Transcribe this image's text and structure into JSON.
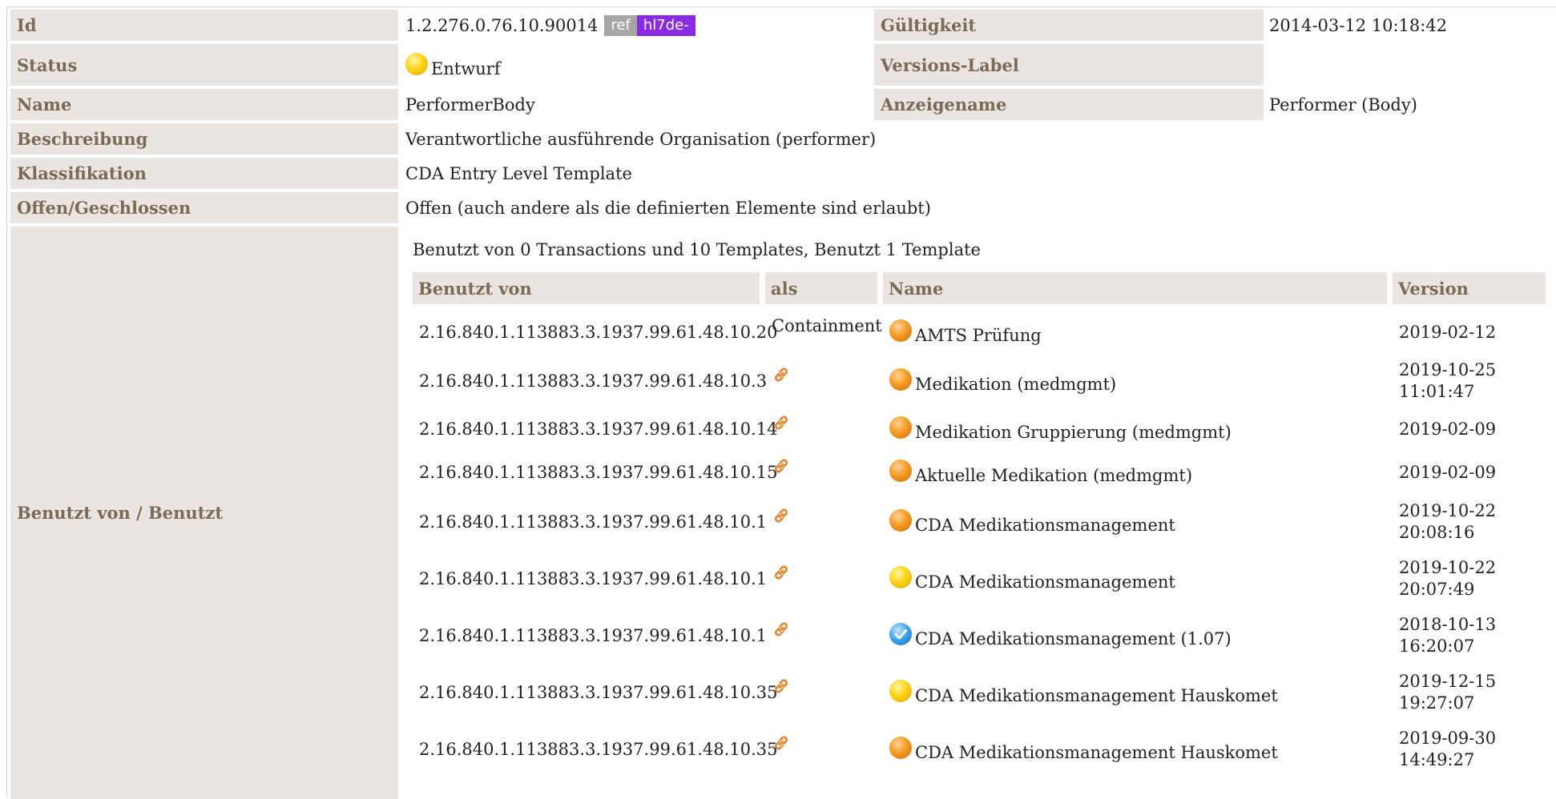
{
  "fields": {
    "id_label": "Id",
    "id_value": "1.2.276.0.76.10.90014",
    "ref_badge": "ref",
    "prefix_badge": "hl7de-",
    "gueltigkeit_label": "Gültigkeit",
    "gueltigkeit_value": "2014-03-12 10:18:42",
    "status_label": "Status",
    "status_value": "Entwurf",
    "status_color": "#ffd21a",
    "versions_label_label": "Versions-Label",
    "versions_label_value": "",
    "name_label": "Name",
    "name_value": "PerformerBody",
    "anzeigename_label": "Anzeigename",
    "anzeigename_value": "Performer (Body)",
    "beschreibung_label": "Beschreibung",
    "beschreibung_value": "Verantwortliche ausführende Organisation (performer)",
    "klassifikation_label": "Klassifikation",
    "klassifikation_value": "CDA Entry Level Template",
    "offen_label": "Offen/Geschlossen",
    "offen_value": "Offen (auch andere als die definierten Elemente sind erlaubt)",
    "benutzt_label": "Benutzt von / Benutzt"
  },
  "usage": {
    "summary": "Benutzt von 0 Transactions und 10 Templates, Benutzt 1 Template",
    "headers": {
      "used_by": "Benutzt von",
      "as": "als",
      "name": "Name",
      "version": "Version"
    },
    "rows": [
      {
        "id": "2.16.840.1.113883.3.1937.99.61.48.10.20",
        "as": "Containment",
        "status": "orange",
        "name": "AMTS Prüfung",
        "version": "2019-02-12"
      },
      {
        "id": "2.16.840.1.113883.3.1937.99.61.48.10.3",
        "as": "",
        "as_icon": "link-icon",
        "status": "orange",
        "name": "Medikation (medmgmt)",
        "version": "2019-10-25 11:01:47"
      },
      {
        "id": "2.16.840.1.113883.3.1937.99.61.48.10.14",
        "as": "",
        "as_icon": "link-icon",
        "status": "orange",
        "name": "Medikation Gruppierung (medmgmt)",
        "version": "2019-02-09"
      },
      {
        "id": "2.16.840.1.113883.3.1937.99.61.48.10.15",
        "as": "",
        "as_icon": "link-icon",
        "status": "orange",
        "name": "Aktuelle Medikation (medmgmt)",
        "version": "2019-02-09"
      },
      {
        "id": "2.16.840.1.113883.3.1937.99.61.48.10.1",
        "as": "",
        "as_icon": "link-icon",
        "status": "orange",
        "name": "CDA Medikationsmanagement",
        "version": "2019-10-22 20:08:16"
      },
      {
        "id": "2.16.840.1.113883.3.1937.99.61.48.10.1",
        "as": "",
        "as_icon": "link-icon",
        "status": "yellow",
        "name": "CDA Medikationsmanagement",
        "version": "2019-10-22 20:07:49"
      },
      {
        "id": "2.16.840.1.113883.3.1937.99.61.48.10.1",
        "as": "",
        "as_icon": "link-icon",
        "status": "blue-check",
        "name": "CDA Medikationsmanagement (1.07)",
        "version": "2018-10-13 16:20:07"
      },
      {
        "id": "2.16.840.1.113883.3.1937.99.61.48.10.35",
        "as": "",
        "as_icon": "link-icon",
        "status": "yellow",
        "name": "CDA Medikationsmanagement Hauskomet",
        "version": "2019-12-15 19:27:07"
      },
      {
        "id": "2.16.840.1.113883.3.1937.99.61.48.10.35",
        "as": "",
        "as_icon": "link-icon",
        "status": "orange",
        "name": "CDA Medikationsmanagement Hauskomet",
        "version": "2019-09-30 14:49:27"
      }
    ]
  },
  "colors": {
    "label_bg": "#eae5e0",
    "label_text": "#7a6a56",
    "ref_badge": "#a6a6a6",
    "prefix_badge": "#8a2be2",
    "link_icon": "#e8822a"
  }
}
